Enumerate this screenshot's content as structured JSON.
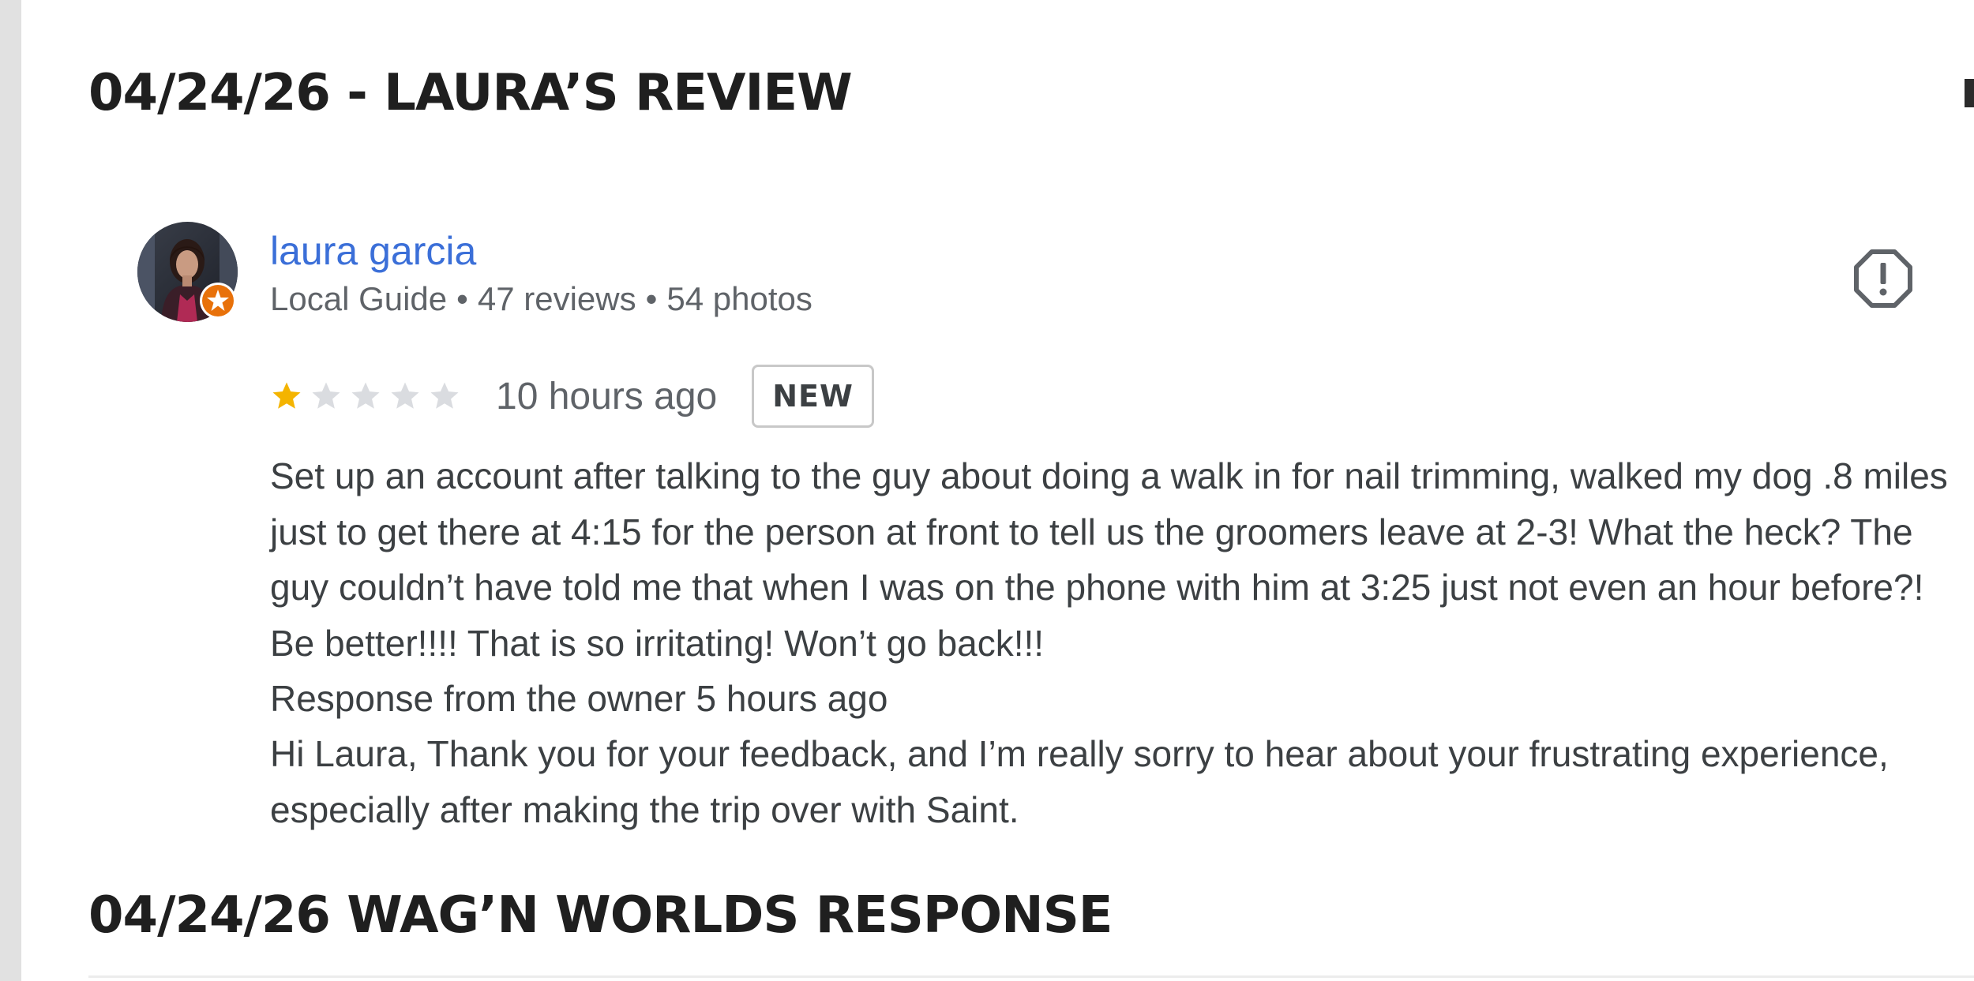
{
  "sections": {
    "review_heading": "04/24/26 - LAURA’S REVIEW",
    "response_heading": "04/24/26 WAG’N WORLDS RESPONSE"
  },
  "review": {
    "reviewer": {
      "name": "laura garcia",
      "badge": "Local Guide",
      "reviews_count": "47 reviews",
      "photos_count": "54 photos",
      "separator": "•",
      "avatar_icon": "profile-photo",
      "guide_badge_icon": "local-guide-star-icon"
    },
    "rating": {
      "value": 1,
      "max": 5,
      "filled_color": "#f4b400",
      "empty_color": "#dadce0"
    },
    "time": "10 hours ago",
    "new_badge": "NEW",
    "text": "Set up an account after talking to the guy about doing a walk in for nail trimming, walked my dog .8 miles just to get there at 4:15 for the person at front to tell us the groomers leave at 2-3! What the heck? The guy couldn’t have told me that when I was on the phone with him at 3:25 just not even an hour before?! Be better!!!! That is so irritating! Won’t go back!!!",
    "owner_response": {
      "label": "Response from the owner 5 hours ago",
      "text": "Hi Laura, Thank you for your feedback, and I’m really sorry to hear about your frustrating experience, especially after making the trip over with Saint."
    },
    "report_icon": "report-flag-icon"
  },
  "colors": {
    "link": "#3b6fd8",
    "heading": "#1f1f1f",
    "body": "#3c4043",
    "muted": "#5f6368",
    "guide_badge": "#e8710a"
  }
}
